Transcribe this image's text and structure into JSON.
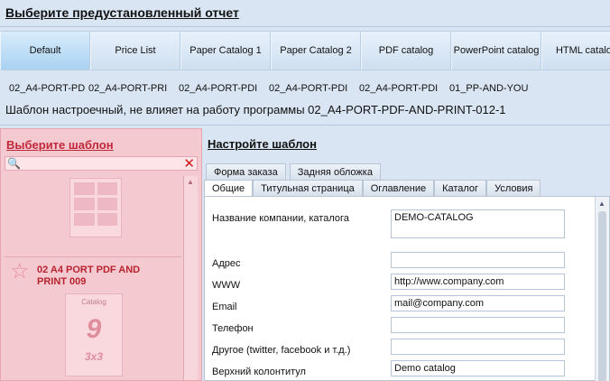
{
  "header": {
    "title": "Выберите предустановленный отчет"
  },
  "report_tabs": [
    {
      "label": "Default",
      "active": true
    },
    {
      "label": "Price List"
    },
    {
      "label": "Paper Catalog 1"
    },
    {
      "label": "Paper Catalog 2"
    },
    {
      "label": "PDF catalog"
    },
    {
      "label": "PowerPoint catalog"
    },
    {
      "label": "HTML catalog"
    }
  ],
  "report_codes": [
    "02_A4-PORT-PD",
    "02_A4-PORT-PRI",
    "02_A4-PORT-PDI",
    "02_A4-PORT-PDI",
    "02_A4-PORT-PDI",
    "01_PP-AND-YOU"
  ],
  "info_text": "Шаблон настроечный, не влияет на работу программы 02_A4-PORT-PDF-AND-PRINT-012-1",
  "left_pane": {
    "title": "Выберите шаблон",
    "items": [
      {
        "label": ""
      },
      {
        "label": "02 A4 PORT PDF AND PRINT 009",
        "thumb_title": "Catalog",
        "thumb_number": "9",
        "thumb_sub": "3x3"
      }
    ]
  },
  "right_pane": {
    "title": "Настройте шаблон",
    "tabs_row1": [
      "Форма заказа",
      "Задняя обложка"
    ],
    "tabs_row2": [
      "Общие",
      "Титульная страница",
      "Оглавление",
      "Каталог",
      "Условия"
    ],
    "active_tab": "Общие",
    "fields": [
      {
        "label": "Название компании, каталога",
        "value": "DEMO-CATALOG"
      },
      {
        "label": "Адрес",
        "value": ""
      },
      {
        "label": "WWW",
        "value": "http://www.company.com"
      },
      {
        "label": "Email",
        "value": "mail@company.com"
      },
      {
        "label": "Телефон",
        "value": ""
      },
      {
        "label": "Другое (twitter, facebook и т.д.)",
        "value": ""
      },
      {
        "label": "Верхний колонтитул",
        "value": "Demo catalog"
      }
    ]
  },
  "colors": {
    "background": "#d9e5f2",
    "left_pane": "#f4c9d0",
    "accent_red": "#c0283a",
    "active_tab": "#a9d2f2"
  },
  "icons": {
    "search": "binoculars-icon",
    "clear": "close-icon",
    "template": "star-icon"
  }
}
